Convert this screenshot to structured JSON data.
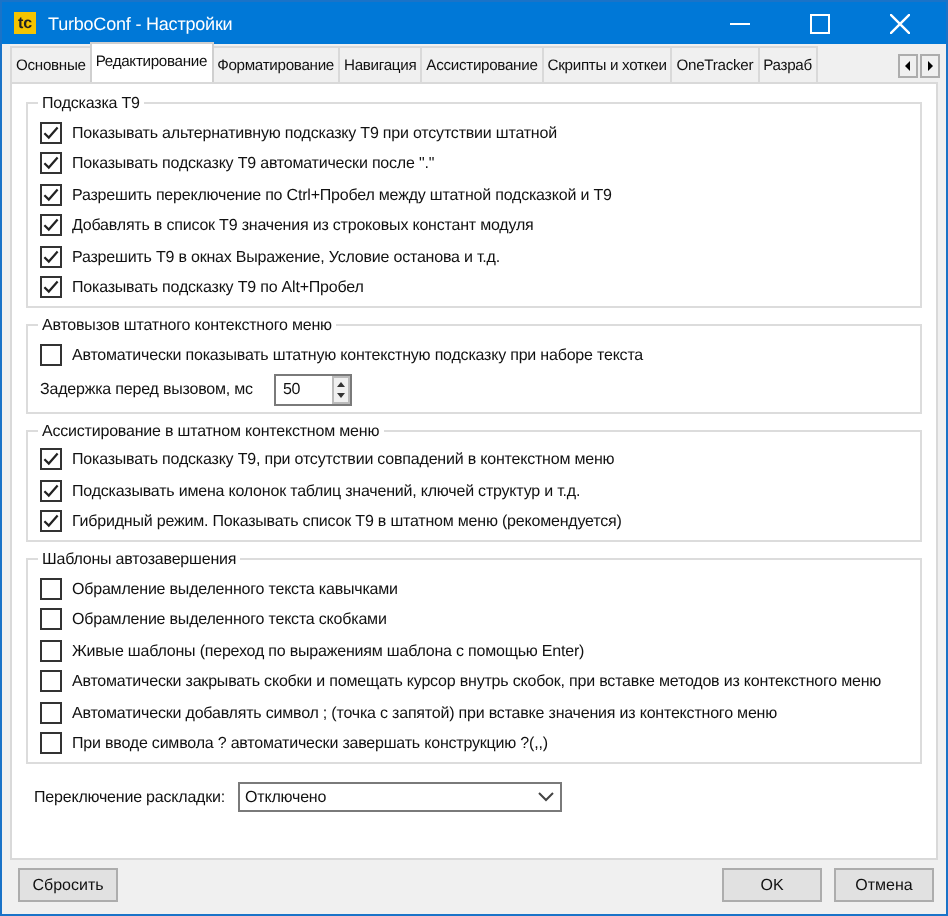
{
  "window": {
    "title": "TurboConf - Настройки",
    "logo": "tc"
  },
  "tabs": [
    {
      "label": "Основные",
      "selected": false
    },
    {
      "label": "Редактирование",
      "selected": true
    },
    {
      "label": "Форматирование",
      "selected": false
    },
    {
      "label": "Навигация",
      "selected": false
    },
    {
      "label": "Ассистирование",
      "selected": false
    },
    {
      "label": "Скрипты и хоткеи",
      "selected": false
    },
    {
      "label": "OneTracker",
      "selected": false
    },
    {
      "label": "Разраб",
      "selected": false
    }
  ],
  "groups": [
    {
      "title": "Подсказка T9",
      "items": [
        {
          "kind": "checkbox",
          "label": "Показывать альтернативную подсказку T9 при отсутствии штатной",
          "checked": true
        },
        {
          "kind": "checkbox",
          "label": "Показывать подсказку T9 автоматически после \".\"",
          "checked": true
        },
        {
          "kind": "checkbox",
          "label": "Разрешить переключение по Ctrl+Пробел между штатной подсказкой и T9",
          "checked": true
        },
        {
          "kind": "checkbox",
          "label": "Добавлять в список T9 значения из строковых констант модуля",
          "checked": true
        },
        {
          "kind": "checkbox",
          "label": "Разрешить T9 в окнах Выражение, Условие останова и т.д.",
          "checked": true
        },
        {
          "kind": "checkbox",
          "label": "Показывать подсказку T9 по Alt+Пробел",
          "checked": true
        }
      ]
    },
    {
      "title": "Автовызов штатного контекстного меню",
      "items": [
        {
          "kind": "checkbox",
          "label": "Автоматически показывать штатную контекстную подсказку при наборе текста",
          "checked": false
        },
        {
          "kind": "spin",
          "label": "Задержка перед вызовом, мс",
          "value": "50"
        }
      ]
    },
    {
      "title": "Ассистирование в штатном контекстном меню",
      "items": [
        {
          "kind": "checkbox",
          "label": "Показывать подсказку T9, при отсутствии совпадений в контекстном меню",
          "checked": true
        },
        {
          "kind": "checkbox",
          "label": "Подсказывать имена колонок таблиц значений, ключей структур и т.д.",
          "checked": true
        },
        {
          "kind": "checkbox",
          "label": "Гибридный режим. Показывать список T9 в штатном меню (рекомендуется)",
          "checked": true
        }
      ]
    },
    {
      "title": "Шаблоны автозавершения",
      "items": [
        {
          "kind": "checkbox",
          "label": "Обрамление выделенного текста кавычками",
          "checked": false
        },
        {
          "kind": "checkbox",
          "label": "Обрамление выделенного текста скобками",
          "checked": false
        },
        {
          "kind": "checkbox",
          "label": "Живые шаблоны (переход по выражениям шаблона с помощью Enter)",
          "checked": false
        },
        {
          "kind": "checkbox",
          "label": "Автоматически закрывать скобки и помещать курсор внутрь скобок, при вставке методов из контекстного меню",
          "checked": false
        },
        {
          "kind": "checkbox",
          "label": "Автоматически добавлять символ ; (точка с запятой) при вставке  значения из контекстного меню",
          "checked": false
        },
        {
          "kind": "checkbox",
          "label": "При вводе символа ? автоматически завершать конструкцию ?(,,)",
          "checked": false
        }
      ]
    }
  ],
  "layout_switch": {
    "label": "Переключение раскладки:",
    "value": "Отключено"
  },
  "buttons": {
    "reset": "Сбросить",
    "ok": "OK",
    "cancel": "Отмена"
  }
}
